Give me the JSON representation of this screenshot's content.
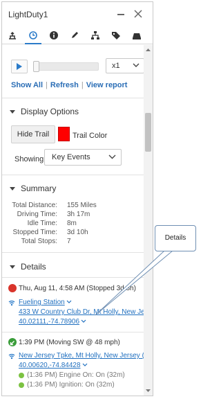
{
  "window": {
    "title": "LightDuty1"
  },
  "toolbar": {
    "tools": [
      "route-icon",
      "history-icon",
      "info-icon",
      "edit-icon",
      "hierarchy-icon",
      "tag-icon",
      "vehicle-icon"
    ],
    "active": "history-icon"
  },
  "playback": {
    "speed": "x1"
  },
  "links": {
    "show_all": "Show All",
    "refresh": "Refresh",
    "view_report": "View report",
    "separator": "|"
  },
  "display_options": {
    "heading": "Display Options",
    "hide_trail": "Hide Trail",
    "trail_color_label": "Trail Color",
    "trail_color": "#ff0000",
    "showing_label": "Showing:",
    "showing_value": "Key Events"
  },
  "summary": {
    "heading": "Summary",
    "rows": [
      {
        "label": "Total Distance:",
        "value": "155 Miles"
      },
      {
        "label": "Driving Time:",
        "value": "3h 17m"
      },
      {
        "label": "Idle Time:",
        "value": "8m"
      },
      {
        "label": "Stopped Time:",
        "value": "3d 10h"
      },
      {
        "label": "Total Stops:",
        "value": "7"
      }
    ]
  },
  "details": {
    "heading": "Details",
    "events": [
      {
        "header": "Thu, Aug 11, 4:58 AM (Stopped 3d 8h)",
        "status_color": "#d9342b",
        "place": "Fueling Station",
        "address": "433 W Country Club Dr, Mt Holly, New Je",
        "coords": "40.02111,-74.78906"
      },
      {
        "header": "1:39 PM (Moving SW @ 48 mph)",
        "status_color": "#3a9d3a",
        "place": "New Jersey Tpke, Mt Holly, New Jersey (",
        "coords": "40.00620,-74.84428",
        "subs": [
          "(1:36 PM) Engine On: On (32m)",
          "(1:36 PM) Ignition: On (32m)"
        ]
      }
    ]
  },
  "callout": {
    "text": "Details"
  },
  "colors": {
    "link": "#2a6db5",
    "accent": "#2b7bc9",
    "green": "#7cc242"
  }
}
